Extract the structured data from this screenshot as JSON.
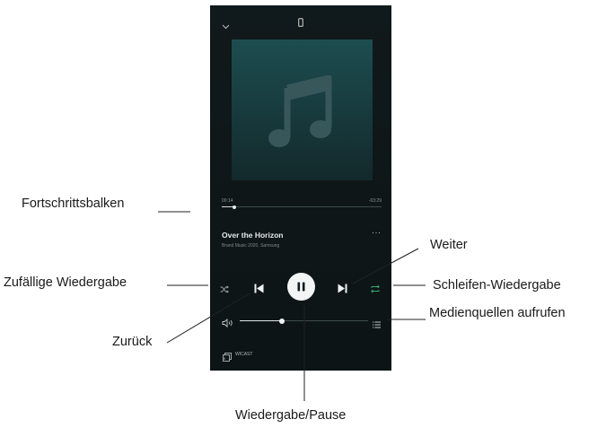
{
  "player": {
    "elapsed": "00:14",
    "remaining": "-03:29",
    "progress_fraction": 0.08,
    "title": "Over the Horizon",
    "subtitle": "Brand Music 2020, Samsung",
    "more_label": "···",
    "volume_fraction": 0.33,
    "source_label": "WICAST",
    "icons": {
      "collapse": "chevron-down-icon",
      "device": "phone-icon",
      "album_art": "music-note-icon",
      "shuffle": "shuffle-icon",
      "previous": "previous-icon",
      "play_pause": "pause-icon",
      "next": "next-icon",
      "repeat": "repeat-icon",
      "volume": "speaker-icon",
      "queue": "queue-list-icon",
      "source": "wicast-icon"
    },
    "colors": {
      "background": "#0e1618",
      "album_art": "#1d4d50",
      "repeat_accent": "#3aa76d"
    }
  },
  "callouts": {
    "progress_bar": "Fortschrittsbalken",
    "shuffle": "Zufällige Wiedergabe",
    "back": "Zurück",
    "next": "Weiter",
    "loop": "Schleifen-Wiedergabe",
    "media_sources": "Medienquellen aufrufen",
    "play_pause": "Wiedergabe/Pause"
  }
}
